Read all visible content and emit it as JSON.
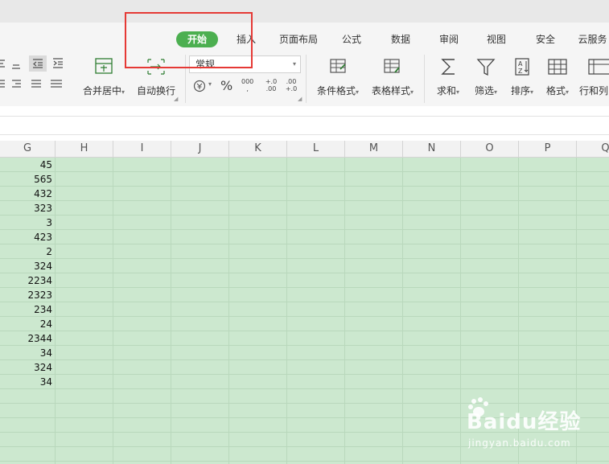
{
  "ribbon": {
    "tabs": [
      "开始",
      "插入",
      "页面布局",
      "公式",
      "数据",
      "审阅",
      "视图",
      "安全",
      "云服务"
    ],
    "active_tab": "开始",
    "buttons": {
      "merge_center": "合并居中",
      "wrap_text": "自动换行",
      "number_format": "常规",
      "cond_format": "条件格式",
      "table_style": "表格样式",
      "sum": "求和",
      "filter": "筛选",
      "sort": "排序",
      "format": "格式",
      "row_col": "行和列"
    },
    "dropdown_arrow": "▾",
    "currency_icon": "currency-icon",
    "percent_symbol": "%",
    "thousands_label": "000",
    "dec_inc_label": "+.0 .00",
    "dec_dec_label": ".00 +.0"
  },
  "columns": [
    "G",
    "H",
    "I",
    "J",
    "K",
    "L",
    "M",
    "N",
    "O",
    "P",
    "Q"
  ],
  "column_g_values": [
    "45",
    "565",
    "432",
    "323",
    "3",
    "423",
    "2",
    "324",
    "2234",
    "2323",
    "234",
    "24",
    "2344",
    "34",
    "324",
    "34"
  ],
  "colors": {
    "accent": "#4caf50",
    "grid_background": "#cce8cf",
    "highlight": "#e53935"
  },
  "watermark": {
    "brand": "Baidu经验",
    "url": "jingyan.baidu.com"
  }
}
